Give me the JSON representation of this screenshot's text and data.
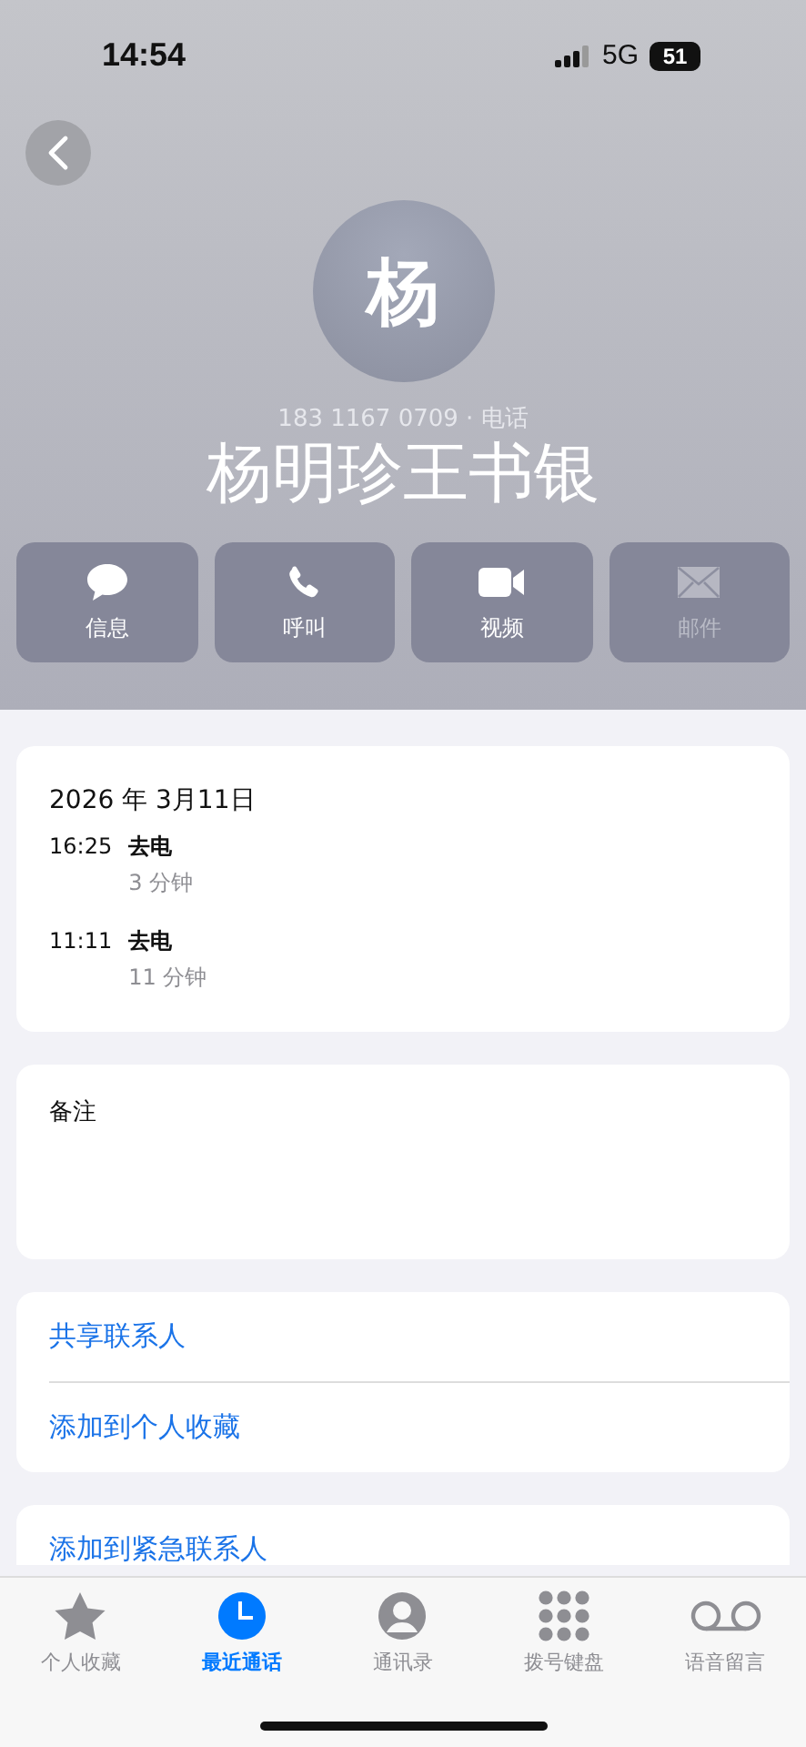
{
  "status_bar": {
    "time": "14:54",
    "network": "5G",
    "battery": "51"
  },
  "contact": {
    "avatar_initial": "杨",
    "subtitle": "183 1167 0709 · 电话",
    "name": "杨明珍王书银"
  },
  "actions": [
    {
      "label": "信息",
      "disabled": false
    },
    {
      "label": "呼叫",
      "disabled": false
    },
    {
      "label": "视频",
      "disabled": false
    },
    {
      "label": "邮件",
      "disabled": true
    }
  ],
  "call_history": {
    "date": "2026 年 3月11日",
    "calls": [
      {
        "time": "16:25",
        "type": "去电",
        "duration": "3 分钟"
      },
      {
        "time": "11:11",
        "type": "去电",
        "duration": "11 分钟"
      }
    ]
  },
  "notes": {
    "label": "备注"
  },
  "links": [
    [
      "共享联系人",
      "添加到个人收藏"
    ],
    [
      "添加到紧急联系人"
    ]
  ],
  "tab_bar": [
    {
      "label": "个人收藏",
      "selected": false
    },
    {
      "label": "最近通话",
      "selected": true
    },
    {
      "label": "通讯录",
      "selected": false
    },
    {
      "label": "拨号键盘",
      "selected": false
    },
    {
      "label": "语音留言",
      "selected": false
    }
  ]
}
